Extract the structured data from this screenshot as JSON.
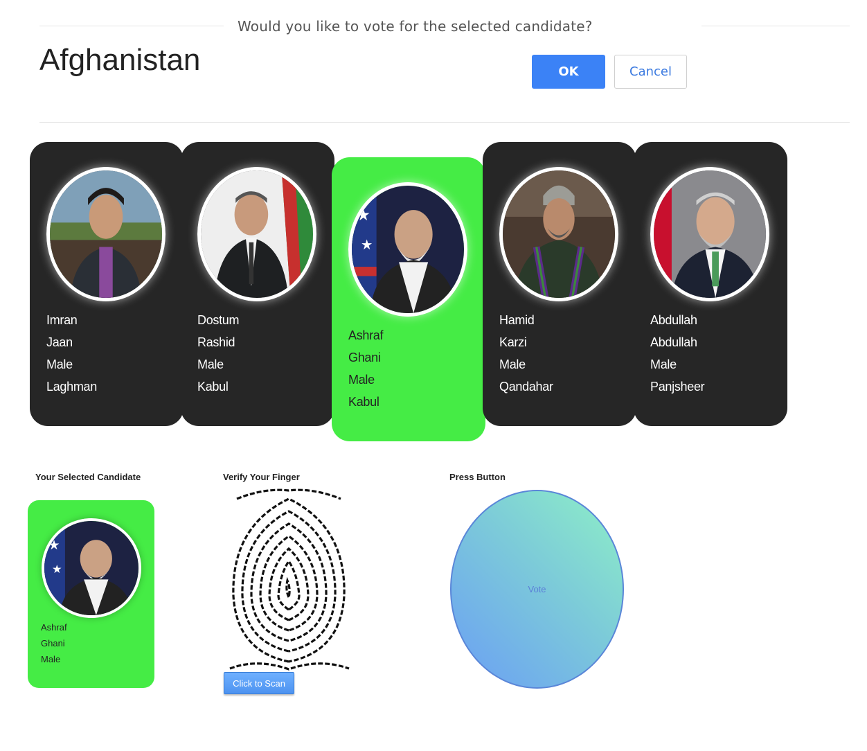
{
  "dialog": {
    "message": "Would you like to vote for the selected candidate?",
    "ok_label": "OK",
    "cancel_label": "Cancel"
  },
  "page": {
    "title": "Afghanistan"
  },
  "candidates": [
    {
      "first_name": "Imran",
      "last_name": "Jaan",
      "gender": "Male",
      "province": "Laghman",
      "selected": false
    },
    {
      "first_name": "Dostum",
      "last_name": "Rashid",
      "gender": "Male",
      "province": "Kabul",
      "selected": false
    },
    {
      "first_name": "Ashraf",
      "last_name": "Ghani",
      "gender": "Male",
      "province": "Kabul",
      "selected": true
    },
    {
      "first_name": "Hamid",
      "last_name": "Karzi",
      "gender": "Male",
      "province": "Qandahar",
      "selected": false
    },
    {
      "first_name": "Abdullah",
      "last_name": "Abdullah",
      "gender": "Male",
      "province": "Panjsheer",
      "selected": false
    }
  ],
  "selected_section": {
    "label": "Your Selected Candidate",
    "first_name": "Ashraf",
    "last_name": "Ghani",
    "gender": "Male"
  },
  "verify_section": {
    "label": "Verify Your Finger",
    "scan_label": "Click to Scan",
    "icon": "fingerprint-icon"
  },
  "vote_section": {
    "label": "Press Button",
    "vote_label": "Vote"
  },
  "colors": {
    "card_bg": "#262626",
    "selected_bg": "#45ec45",
    "ok_button": "#3b82f6",
    "cancel_text": "#3b7ae0"
  }
}
